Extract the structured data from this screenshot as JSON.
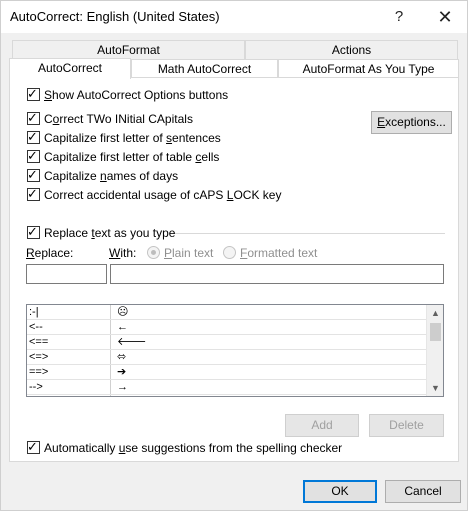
{
  "window": {
    "title": "AutoCorrect: English (United States)",
    "help_glyph": "?",
    "close_glyph": "✕"
  },
  "tabs": {
    "row1": [
      "AutoFormat",
      "Actions"
    ],
    "row2": [
      "AutoCorrect",
      "Math AutoCorrect",
      "AutoFormat As You Type"
    ]
  },
  "options": {
    "show_buttons": {
      "pre": "",
      "u": "S",
      "post": "how AutoCorrect Options buttons",
      "checked": true
    },
    "two_initials": {
      "pre": "C",
      "u": "o",
      "post": "rrect TWo INitial CApitals",
      "checked": true
    },
    "cap_sentences": {
      "pre": "Capitalize first letter of ",
      "u": "s",
      "post": "entences",
      "checked": true
    },
    "cap_table": {
      "pre": "Capitalize first letter of table ",
      "u": "c",
      "post": "ells",
      "checked": true
    },
    "cap_days": {
      "pre": "Capitalize ",
      "u": "n",
      "post": "ames of days",
      "checked": true
    },
    "caps_lock": {
      "pre": "Correct accidental usage of cAPS ",
      "u": "L",
      "post": "OCK key",
      "checked": true
    },
    "check_glyph": "✓"
  },
  "exceptions_button": {
    "pre": "",
    "u": "E",
    "post": "xceptions..."
  },
  "replace": {
    "checkbox": {
      "pre": "Replace ",
      "u": "t",
      "post": "ext as you type",
      "checked": true
    },
    "replace_label": {
      "pre": "",
      "u": "R",
      "post": "eplace:"
    },
    "with_label": {
      "pre": "",
      "u": "W",
      "post": "ith:"
    },
    "plain_text": {
      "pre": "",
      "u": "P",
      "post": "lain text"
    },
    "formatted_text": {
      "pre": "",
      "u": "F",
      "post": "ormatted text"
    },
    "replace_value": "",
    "with_value": ""
  },
  "entries": [
    {
      "replace": ":-|",
      "with": "☹"
    },
    {
      "replace": "<--",
      "with": "←"
    },
    {
      "replace": "<==",
      "with": "🡐"
    },
    {
      "replace": "<=>",
      "with": "⬄"
    },
    {
      "replace": "==>",
      "with": "➔"
    },
    {
      "replace": "-->",
      "with": "→"
    }
  ],
  "scroll": {
    "up": "▲",
    "down": "▼"
  },
  "list_buttons": {
    "add": "Add",
    "delete": "Delete"
  },
  "spelling": {
    "pre": "Automatically ",
    "u": "u",
    "post": "se suggestions from the spelling checker",
    "checked": true
  },
  "footer": {
    "ok": "OK",
    "cancel": "Cancel"
  }
}
